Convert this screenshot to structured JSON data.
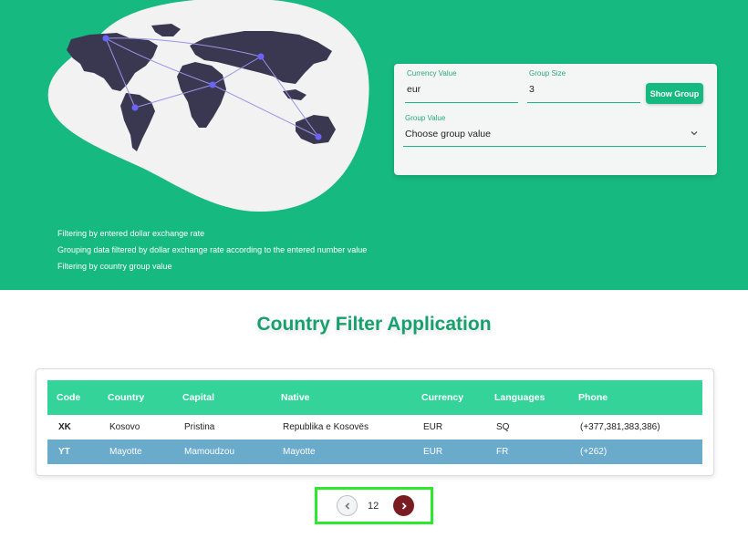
{
  "features": [
    "Filtering by entered dollar exchange rate",
    "Grouping data filtered by dollar exchange rate according to the entered number value",
    "Filtering by country group value"
  ],
  "form": {
    "currency_label": "Currency Value",
    "currency_value": "eur",
    "group_size_label": "Group Size",
    "group_size_value": "3",
    "show_group_label": "Show Group",
    "group_value_label": "Group Value",
    "group_value_selected": "Choose group value"
  },
  "title": "Country Filter Application",
  "table": {
    "columns": [
      "Code",
      "Country",
      "Capital",
      "Native",
      "Currency",
      "Languages",
      "Phone"
    ],
    "rows": [
      [
        "XK",
        "Kosovo",
        "Pristina",
        "Republika e Kosovës",
        "EUR",
        "SQ",
        "(+377,381,383,386)"
      ],
      [
        "YT",
        "Mayotte",
        "Mamoudzou",
        "Mayotte",
        "EUR",
        "FR",
        "(+262)"
      ]
    ]
  },
  "pagination": {
    "page": "12"
  },
  "colors": {
    "brand": "#16b97f",
    "header": "#34d399",
    "selected_row": "#6aaacb",
    "next_button": "#7a1d22"
  }
}
